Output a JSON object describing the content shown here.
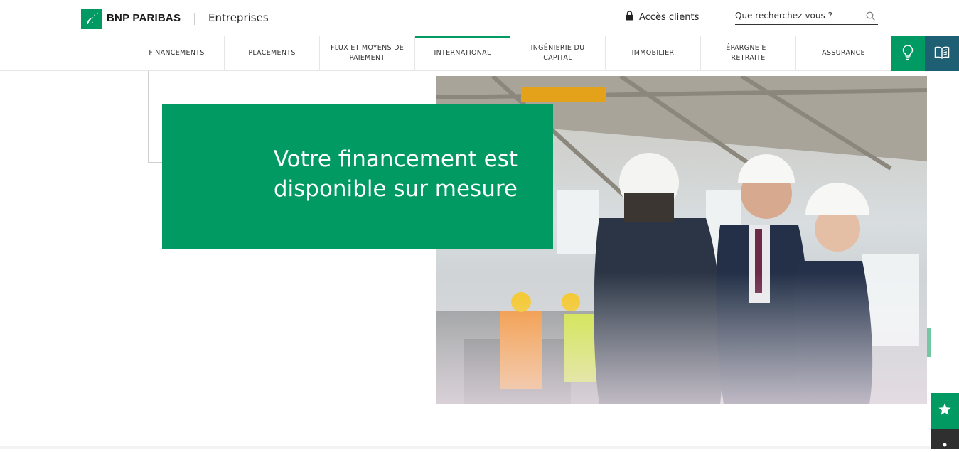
{
  "header": {
    "brand": "BNP PARIBAS",
    "section": "Entreprises",
    "access_label": "Accès clients",
    "search_placeholder": "Que recherchez-vous ?"
  },
  "nav": {
    "items": [
      {
        "label": "FINANCEMENTS"
      },
      {
        "label": "PLACEMENTS"
      },
      {
        "label": "FLUX ET MOYENS DE PAIEMENT"
      },
      {
        "label": "INTERNATIONAL",
        "active": true
      },
      {
        "label": "INGÉNIERIE DU CAPITAL"
      },
      {
        "label": "IMMOBILIER"
      },
      {
        "label": "ÉPARGNE ET RETRAITE"
      },
      {
        "label": "ASSURANCE"
      }
    ],
    "icon_buttons": [
      "lightbulb-icon",
      "book-icon"
    ]
  },
  "hero": {
    "title": "Votre financement est disponible sur mesure",
    "image": "industrial workshop with three businesspeople in white hard hats shaking hands, workers in orange and yellow safety vests in background"
  },
  "floating": {
    "favorite_icon": "star-icon"
  },
  "colors": {
    "brand_green": "#009a62",
    "teal": "#1e5f73",
    "light_green": "#74c7a3"
  }
}
